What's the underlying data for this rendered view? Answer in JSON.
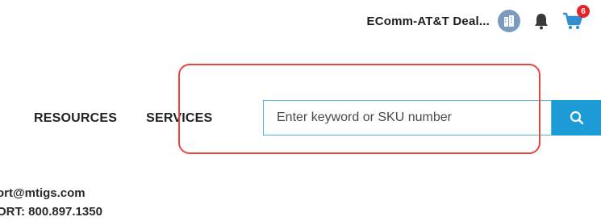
{
  "header": {
    "account_name": "EComm-AT&T Deal...",
    "cart_count": "6",
    "icons": {
      "avatar": "building-icon",
      "notifications": "bell-icon",
      "cart": "cart-icon"
    },
    "colors": {
      "avatar": "#7a9bbf",
      "badge": "#e5242a"
    }
  },
  "nav": {
    "items": [
      {
        "label": "RESOURCES"
      },
      {
        "label": "SERVICES"
      }
    ]
  },
  "search": {
    "placeholder": "Enter keyword or SKU number",
    "value": "",
    "button_icon": "search-icon",
    "accent": "#1c9bd7"
  },
  "support": {
    "email": "ort@mtigs.com",
    "phone": "ORT: 800.897.1350"
  },
  "annotation": {
    "color": "#e8463f"
  }
}
